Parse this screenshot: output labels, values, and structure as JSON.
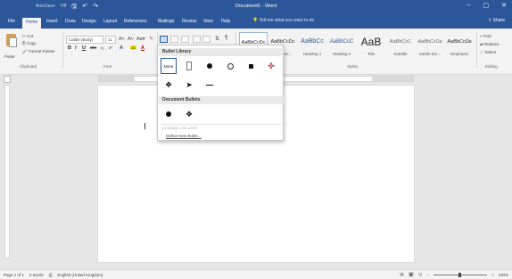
{
  "title_bar": {
    "autosave": "AutoSave",
    "autosave_state": "Off",
    "document_title": "Document1 - Word",
    "undo_glyph": "↶",
    "redo_glyph": "↷",
    "save_glyph": "🖫",
    "minimize_glyph": "–",
    "restore_glyph": "▢",
    "close_glyph": "✕"
  },
  "tabs": [
    "File",
    "Home",
    "Insert",
    "Draw",
    "Design",
    "Layout",
    "References",
    "Mailings",
    "Review",
    "View",
    "Help"
  ],
  "active_tab": "Home",
  "tell_me": "Tell me what you want to do",
  "share_label": "Share",
  "clipboard": {
    "paste": "Paste",
    "cut": "Cut",
    "copy": "Copy",
    "format_painter": "Format Painter",
    "group": "Clipboard"
  },
  "font": {
    "name": "Calibri (Body)",
    "size": "11",
    "bold": "B",
    "italic": "I",
    "underline": "U",
    "strike": "abc",
    "subscript": "x₂",
    "superscript": "x²",
    "group": "Font"
  },
  "paragraph": {
    "group": "Paragraph"
  },
  "styles": {
    "items": [
      {
        "preview": "AaBbCcDc",
        "name": "¶ Normal"
      },
      {
        "preview": "AaBbCcDc",
        "name": "No Spac..."
      },
      {
        "preview": "AaBbCc",
        "name": "Heading 1"
      },
      {
        "preview": "AaBbCcC",
        "name": "Heading 2"
      },
      {
        "preview": "AaB",
        "name": "Title"
      },
      {
        "preview": "AaBbCcC",
        "name": "Subtitle"
      },
      {
        "preview": "AaBbCcDa",
        "name": "Subtle Em..."
      },
      {
        "preview": "AaBbCcDa",
        "name": "Emphasis"
      }
    ],
    "group": "Styles"
  },
  "editing": {
    "find": "Find",
    "replace": "Replace",
    "select": "Select",
    "group": "Editing"
  },
  "bullet_menu": {
    "library_title": "Bullet Library",
    "none_label": "None",
    "library_glyphs": [
      "none",
      "box",
      "solid",
      "hollow",
      "square",
      "✤",
      "❖",
      "➤",
      "dash"
    ],
    "document_title": "Document Bullets",
    "document_glyphs": [
      "solid",
      "❖"
    ],
    "change_list_level": "Change List Level",
    "define_new_bullet": "Define New Bullet..."
  },
  "status": {
    "page": "Page 1 of 1",
    "words": "0 words",
    "language": "English (United Kingdom)",
    "zoom": "100%"
  }
}
